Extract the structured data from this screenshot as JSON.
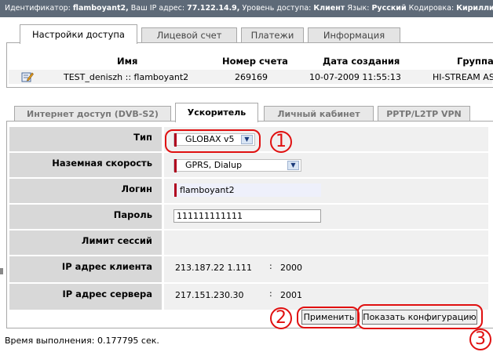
{
  "topbar": {
    "id_label": "Идентификатор:",
    "id_value": "flamboyant2,",
    "ip_label": "Ваш IP адрес:",
    "ip_value": "77.122.14.9,",
    "access_label": "Уровень доступа:",
    "access_value": "Клиент",
    "lang_label": "Язык:",
    "lang_value": "Русский",
    "enc_label": "Кодировка:",
    "enc_value": "Кирилли"
  },
  "main_tabs": [
    "Настройки доступа",
    "Лицевой счет",
    "Платежи",
    "Информация"
  ],
  "accounts_table": {
    "headers": [
      "Имя",
      "Номер счета",
      "Дата создания",
      "Группа"
    ],
    "rows": [
      {
        "name": "TEST_deniszh :: flamboyant2",
        "account": "269169",
        "created": "10-07-2009 11:55:13",
        "group": "HI-STREAM AS"
      }
    ]
  },
  "service_tabs": [
    "Интернет доступ (DVB-S2)",
    "Ускоритель",
    "Личный кабинет",
    "PPTP/L2TP VPN"
  ],
  "form": {
    "type_label": "Тип",
    "type_value": "GLOBAX v5",
    "speed_label": "Наземная скорость",
    "speed_value": "GPRS, Dialup",
    "login_label": "Логин",
    "login_value": "flamboyant2",
    "password_label": "Пароль",
    "password_value": "111111111111",
    "session_limit_label": "Лимит сессий",
    "client_ip_label": "IP адрес клиента",
    "client_ip_value": "213.187.22 1.111",
    "client_port_sep": ":",
    "client_port": "2000",
    "server_ip_label": "IP адрес сервера",
    "server_ip_value": "217.151.230.30",
    "server_port_sep": ":",
    "server_port": "2001"
  },
  "buttons": {
    "apply": "Применить",
    "show_config": "Показать конфигурацию"
  },
  "annotations": [
    "1",
    "2",
    "3"
  ],
  "footer": "Время выполнения: 0.177795 сек.",
  "colors": {
    "topbar": "#5e6a78",
    "label_bg": "#d8d8d8",
    "value_bg": "#f0f0f0",
    "required_marker": "#b0001e",
    "annotation": "#e01010"
  }
}
